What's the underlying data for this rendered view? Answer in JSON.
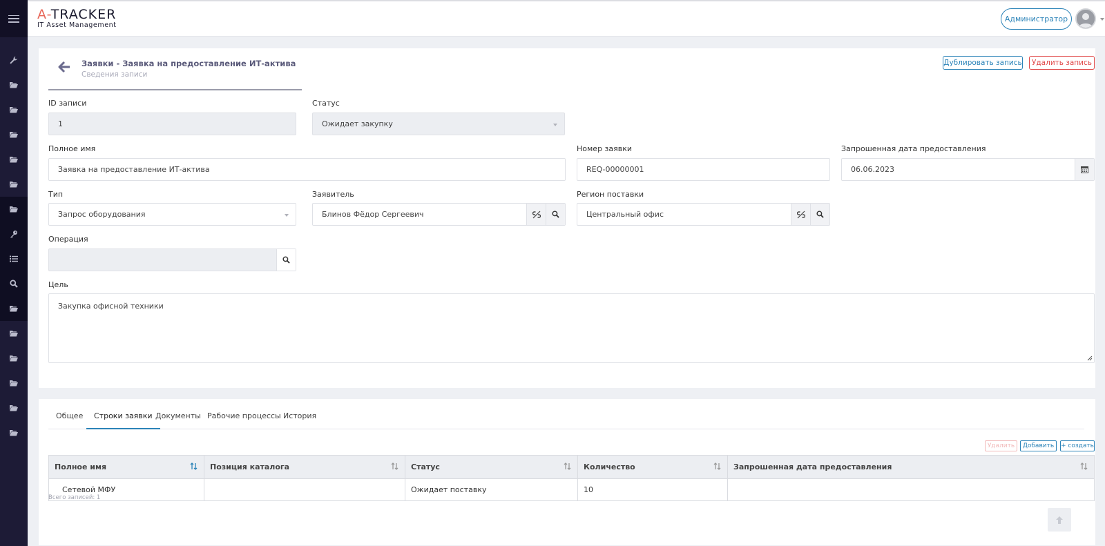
{
  "app": {
    "logo_prefix": "A-",
    "logo_main": "TRACKER",
    "logo_subtitle": "IT Asset Management",
    "user_label": "Администратор"
  },
  "sidebar": {
    "items": [
      "wrench-icon",
      "folder-icon",
      "folder-icon",
      "folder-icon",
      "folder-icon",
      "folder-icon",
      "folder-icon",
      "key-icon",
      "list-icon",
      "search-icon",
      "folder-icon",
      "folder-icon",
      "folder-icon",
      "folder-icon",
      "folder-icon",
      "folder-icon"
    ]
  },
  "record": {
    "title": "Заявки - Заявка на предоставление ИТ-актива",
    "subtitle": "Сведения записи",
    "duplicate_label": "Дублировать запись",
    "delete_label": "Удалить запись"
  },
  "form": {
    "id_label": "ID записи",
    "id_value": "1",
    "status_label": "Статус",
    "status_value": "Ожидает закупку",
    "fullname_label": "Полное имя",
    "fullname_value": "Заявка на предоставление ИТ-актива",
    "reqnum_label": "Номер заявки",
    "reqnum_value": "REQ-00000001",
    "reqdate_label": "Запрошенная дата предоставления",
    "reqdate_value": "06.06.2023",
    "type_label": "Тип",
    "type_value": "Запрос оборудования",
    "requester_label": "Заявитель",
    "requester_value": "Блинов Фёдор Сергеевич",
    "region_label": "Регион поставки",
    "region_value": "Центральный офис",
    "operation_label": "Операция",
    "operation_value": "",
    "purpose_label": "Цель",
    "purpose_value": "Закупка офисной техники"
  },
  "tabs": [
    {
      "label": "Общее",
      "active": false
    },
    {
      "label": "Строки заявки",
      "active": true
    },
    {
      "label": "Документы",
      "active": false
    },
    {
      "label": "Рабочие процессы",
      "active": false
    },
    {
      "label": "История",
      "active": false
    }
  ],
  "lines": {
    "delete_label": "Удалить",
    "add_label": "Добавить",
    "create_label": "+ создать",
    "columns": [
      "Полное имя",
      "Позиция каталога",
      "Статус",
      "Количество",
      "Запрошенная дата предоставления"
    ],
    "rows": [
      [
        "Сетевой МФУ",
        "",
        "Ожидает поставку",
        "10",
        ""
      ]
    ],
    "total": "Всего записей: 1"
  },
  "colors": {
    "accent": "#2b83b8",
    "danger": "#e04848",
    "sidebar": "#1d1b36",
    "logo_accent": "#e8685a"
  }
}
